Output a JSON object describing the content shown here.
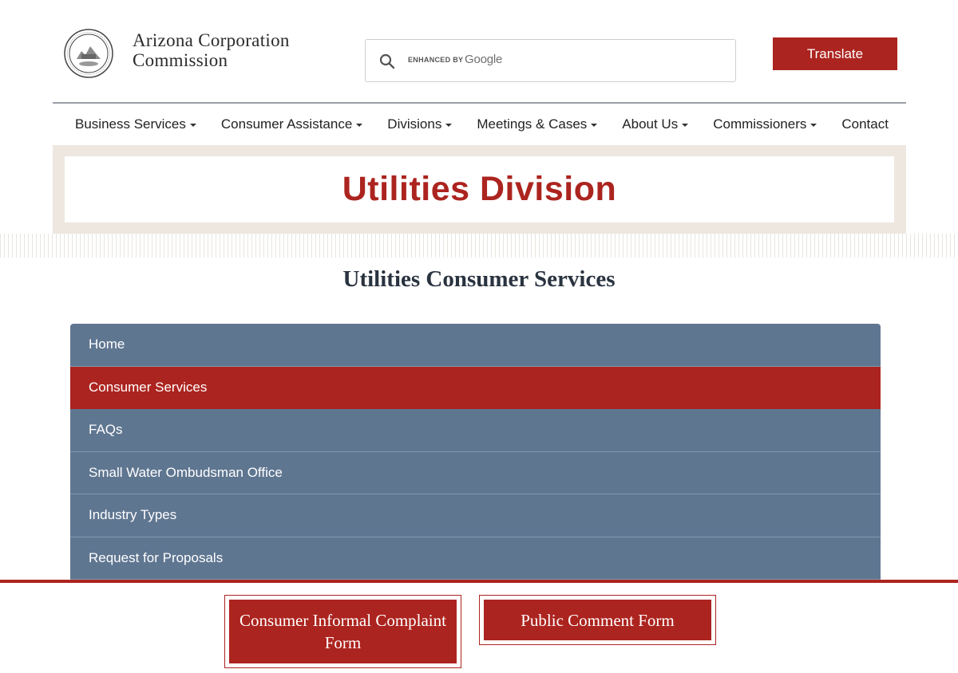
{
  "header": {
    "brand_line1": "Arizona Corporation",
    "brand_line2": "Commission",
    "search": {
      "enhanced_by": "ENHANCED BY",
      "provider": "Google"
    },
    "translate_label": "Translate"
  },
  "nav": {
    "items": [
      {
        "label": "Business Services",
        "has_dropdown": true
      },
      {
        "label": "Consumer Assistance",
        "has_dropdown": true
      },
      {
        "label": "Divisions",
        "has_dropdown": true
      },
      {
        "label": "Meetings & Cases",
        "has_dropdown": true
      },
      {
        "label": "About Us",
        "has_dropdown": true
      },
      {
        "label": "Commissioners",
        "has_dropdown": true
      },
      {
        "label": "Contact",
        "has_dropdown": false
      }
    ]
  },
  "banner": {
    "title": "Utilities Division"
  },
  "section": {
    "title": "Utilities Consumer Services"
  },
  "side_menu": {
    "items": [
      {
        "label": "Home",
        "active": false
      },
      {
        "label": "Consumer Services",
        "active": true
      },
      {
        "label": "FAQs",
        "active": false
      },
      {
        "label": "Small Water Ombudsman Office",
        "active": false
      },
      {
        "label": "Industry Types",
        "active": false
      },
      {
        "label": "Request for Proposals",
        "active": false
      }
    ]
  },
  "footer": {
    "complaint_form_label": "Consumer Informal Complaint Form",
    "comment_form_label": "Public Comment Form"
  },
  "colors": {
    "brand_red": "#ac241f",
    "menu_slate": "#5f7691",
    "banner_beige": "#ede7df",
    "heading_navy": "#2a3340"
  }
}
